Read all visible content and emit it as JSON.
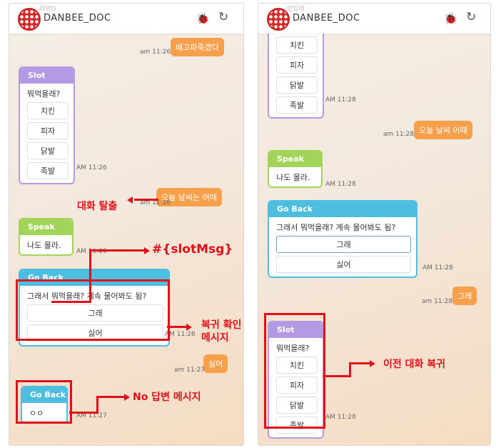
{
  "app": {
    "brand": "DANBEE_DOC",
    "bug_icon": "bug-icon",
    "refresh_icon": "refresh-icon"
  },
  "colors": {
    "user_bubble": "#f6a04c",
    "slot": "#b49ae2",
    "speak": "#a3d45a",
    "goback": "#4dbde0",
    "annotation": "#e0101a"
  },
  "left": {
    "faint_top": "라엄D",
    "msg1": {
      "text": "배고파죽겠다",
      "time": "am 11:26"
    },
    "slot": {
      "header": "Slot",
      "question": "뭐먹을래?",
      "options": [
        "치킨",
        "피자",
        "닭발",
        "족발"
      ],
      "time": "AM 11:26"
    },
    "msg2": {
      "text": "오늘 날씨는 어때",
      "time": "am 11:26"
    },
    "speak": {
      "header": "Speak",
      "text": "나도 몰라.",
      "time": "AM 11:26"
    },
    "goback": {
      "header": "Go Back",
      "question": "그래서 뭐먹을래? 계속 물어봐도 됨?",
      "options": [
        "그래",
        "싫어"
      ],
      "time": "AM 11:26"
    },
    "msg3": {
      "text": "싫어",
      "time": "am 11:27"
    },
    "goback2": {
      "header": "Go Back",
      "text": "ㅇㅇ",
      "time": "AM 11:27"
    }
  },
  "right": {
    "faint_top": "맛있래",
    "slot": {
      "options": [
        "치킨",
        "피자",
        "닭발",
        "족발"
      ],
      "time": "AM 11:28"
    },
    "msg1": {
      "text": "오늘 날씨 어때",
      "time": "am 11:28"
    },
    "speak": {
      "header": "Speak",
      "text": "나도 몰라.",
      "time": "AM 11:28"
    },
    "goback": {
      "header": "Go Back",
      "question": "그래서 뭐먹을래? 계속 물어봐도 됨?",
      "options": [
        "그래",
        "싫어"
      ],
      "time": "AM 11:28"
    },
    "msg2": {
      "text": "그래",
      "time": "am 11:28"
    },
    "slot2": {
      "header": "Slot",
      "question": "뭐먹을래?",
      "options": [
        "치킨",
        "피자",
        "닭발",
        "족발"
      ],
      "time": "AM 11:28"
    }
  },
  "annotations": {
    "escape": "대화 탈출",
    "slotmsg": "#{slotMsg}",
    "return_confirm_line1": "복귀 확인",
    "return_confirm_line2": "메시지",
    "no_answer": "No 답변 메시지",
    "prev_return": "이전 대화 복귀"
  }
}
